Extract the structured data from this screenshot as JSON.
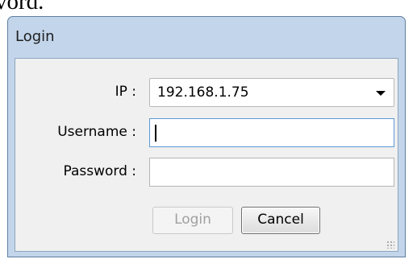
{
  "background_text": "vord.",
  "window": {
    "title": "Login",
    "ip": {
      "label": "IP :",
      "value": "192.168.1.75"
    },
    "username": {
      "label": "Username :",
      "value": ""
    },
    "password": {
      "label": "Password :",
      "value": ""
    },
    "buttons": {
      "login": "Login",
      "cancel": "Cancel"
    }
  },
  "colors": {
    "title_bar": "#c2d5ea",
    "client_bg": "#f0f0f0",
    "focus_border": "#5d9ad6"
  },
  "icons": {
    "combo_arrow": "chevron-down-icon",
    "resize_grip": "resize-grip-icon"
  }
}
